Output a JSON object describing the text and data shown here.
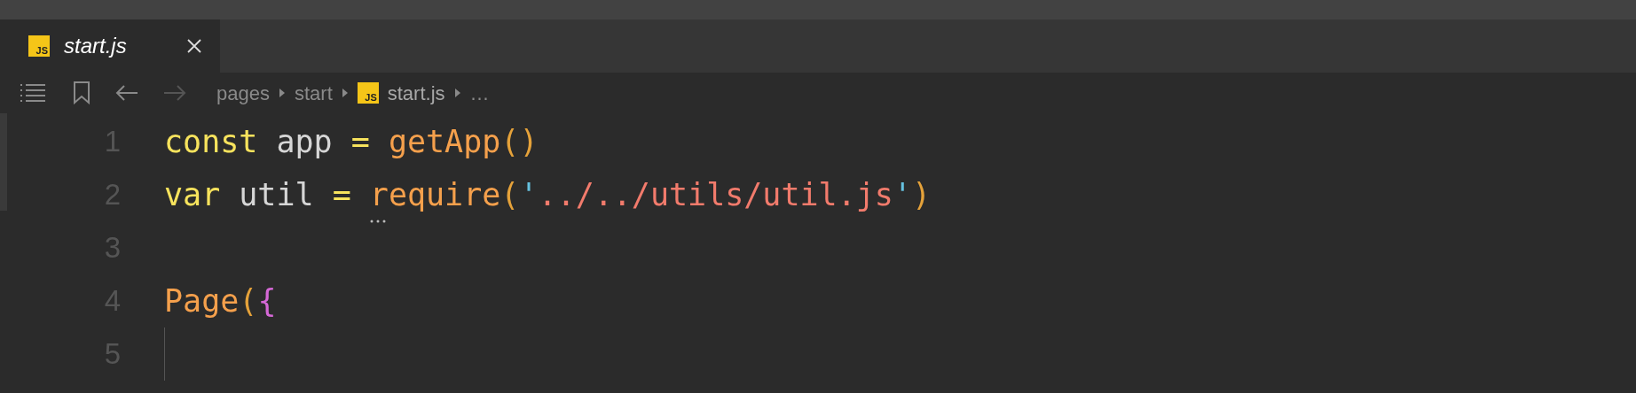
{
  "tabs": [
    {
      "label": "start.js",
      "icon": "JS",
      "selected": true
    }
  ],
  "breadcrumb": [
    {
      "kind": "folder",
      "label": "pages"
    },
    {
      "kind": "folder",
      "label": "start"
    },
    {
      "kind": "file",
      "icon": "JS",
      "label": "start.js"
    },
    {
      "kind": "more",
      "label": "…"
    }
  ],
  "code_lines": [
    {
      "number": "1",
      "tokens": [
        {
          "text": "const",
          "kind": "keyword"
        },
        {
          "text": " app ",
          "kind": "ident"
        },
        {
          "text": "= ",
          "kind": "operator"
        },
        {
          "text": "getApp",
          "kind": "function"
        },
        {
          "text": "()",
          "kind": "paren"
        }
      ]
    },
    {
      "number": "2",
      "tokens": [
        {
          "text": "var",
          "kind": "keyword"
        },
        {
          "text": " util ",
          "kind": "ident"
        },
        {
          "text": "= ",
          "kind": "operator"
        },
        {
          "text": "require",
          "kind": "function",
          "hint": true
        },
        {
          "text": "(",
          "kind": "paren"
        },
        {
          "text": "'",
          "kind": "quote"
        },
        {
          "text": "../../utils/util.js",
          "kind": "string"
        },
        {
          "text": "'",
          "kind": "quote"
        },
        {
          "text": ")",
          "kind": "paren"
        }
      ]
    },
    {
      "number": "3"
    },
    {
      "number": "4",
      "tokens": [
        {
          "text": "Page",
          "kind": "function"
        },
        {
          "text": "(",
          "kind": "paren"
        },
        {
          "text": "{",
          "kind": "brace"
        }
      ]
    },
    {
      "number": "5",
      "indent_guide": true
    }
  ]
}
